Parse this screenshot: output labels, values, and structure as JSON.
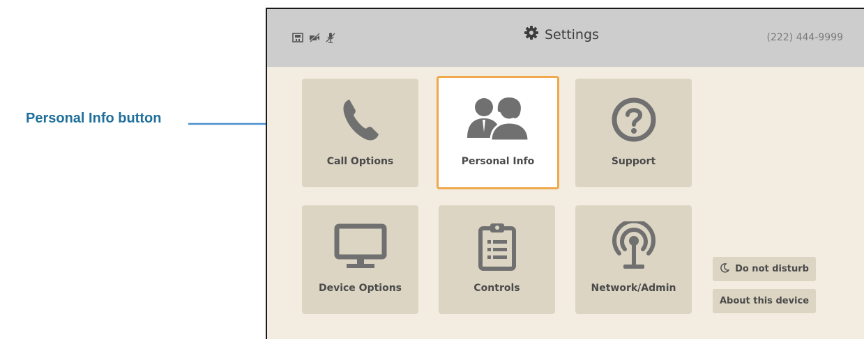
{
  "callout": {
    "label": "Personal Info button"
  },
  "header": {
    "title": "Settings",
    "phone_number": "(222) 444-9999",
    "status_icons": [
      "network-icon",
      "video-off-icon",
      "mic-off-icon"
    ]
  },
  "tiles": [
    {
      "label": "Call Options",
      "icon": "phone-icon"
    },
    {
      "label": "Personal Info",
      "icon": "people-icon",
      "selected": true
    },
    {
      "label": "Support",
      "icon": "help-icon"
    },
    {
      "label": "Device Options",
      "icon": "monitor-icon"
    },
    {
      "label": "Controls",
      "icon": "clipboard-icon"
    },
    {
      "label": "Network/Admin",
      "icon": "antenna-icon"
    }
  ],
  "side_buttons": {
    "do_not_disturb": "Do not disturb",
    "about_device": "About this device"
  },
  "colors": {
    "accent_selected_border": "#f0a84a",
    "callout_text": "#1f6f9b",
    "callout_arrow": "#4a8fd0"
  }
}
